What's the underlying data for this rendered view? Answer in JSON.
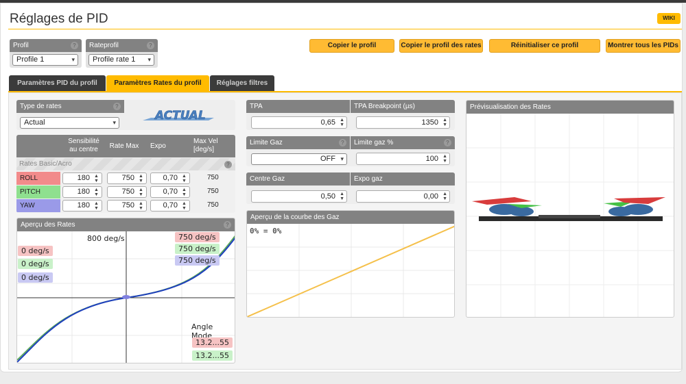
{
  "page": {
    "title": "Réglages de PID",
    "wiki": "WIKI"
  },
  "profile": {
    "label": "Profil",
    "value": "Profile 1"
  },
  "rateprofile": {
    "label": "Rateprofil",
    "value": "Profile rate 1"
  },
  "buttons": {
    "copy_profile": "Copier le profil",
    "copy_rates": "Copier le profil des rates",
    "reset_profile": "Réinitialiser ce profil",
    "show_all_pids": "Montrer tous les PIDs"
  },
  "tabs": [
    {
      "label": "Paramètres PID du profil",
      "active": false
    },
    {
      "label": "Paramètres Rates du profil",
      "active": true
    },
    {
      "label": "Réglages filtres",
      "active": false
    }
  ],
  "rates_type": {
    "label": "Type de rates",
    "value": "Actual",
    "logo": "ACTUAL"
  },
  "rates_table": {
    "headers": [
      "",
      "Sensibilité au centre",
      "Rate Max",
      "Expo",
      "Max Vel [deg/s]"
    ],
    "section": "Rates Basic/Acro",
    "rows": [
      {
        "axis": "ROLL",
        "center": "180",
        "max": "750",
        "expo": "0,70",
        "vel": "750",
        "color": "#f28b8b"
      },
      {
        "axis": "PITCH",
        "center": "180",
        "max": "750",
        "expo": "0,70",
        "vel": "750",
        "color": "#8fe08f"
      },
      {
        "axis": "YAW",
        "center": "180",
        "max": "750",
        "expo": "0,70",
        "vel": "750",
        "color": "#9a9ae8"
      }
    ]
  },
  "rates_preview": {
    "title": "Aperçu des Rates",
    "max_label": "800 deg/s",
    "current": [
      "0 deg/s",
      "0 deg/s",
      "0 deg/s"
    ],
    "max_rates": [
      "750 deg/s",
      "750 deg/s",
      "750 deg/s"
    ],
    "angle_mode": "Angle Mode",
    "angle_values": [
      "13.2...55",
      "13.2...55"
    ]
  },
  "tpa": {
    "tpa_label": "TPA",
    "tpa_value": "0,65",
    "breakpoint_label": "TPA Breakpoint (µs)",
    "breakpoint_value": "1350",
    "limit_label": "Limite Gaz",
    "limit_value": "OFF",
    "limit_pct_label": "Limite gaz %",
    "limit_pct_value": "100",
    "mid_label": "Centre Gaz",
    "mid_value": "0,50",
    "expo_label": "Expo gaz",
    "expo_value": "0,00"
  },
  "throttle_curve": {
    "title": "Aperçu de la courbe des Gaz",
    "readout": "0% = 0%"
  },
  "rates_3d": {
    "title": "Prévisualisation des Rates"
  },
  "colors": {
    "accent": "#ffbb00",
    "roll": "#f28b8b",
    "pitch": "#8fe08f",
    "yaw": "#9a9ae8"
  }
}
